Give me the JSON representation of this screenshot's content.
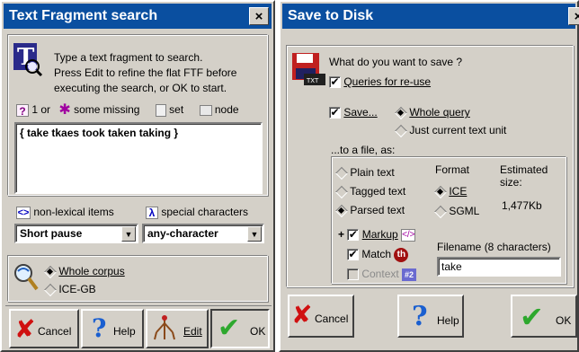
{
  "search_dialog": {
    "title": "Text Fragment search",
    "close": "×",
    "intro_line1": "Type a text fragment to search.",
    "intro_line2": "Press Edit to refine the flat FTF before",
    "intro_line3": "executing the search, or OK to start.",
    "legend": {
      "one_or": "1 or",
      "some_missing": "some missing",
      "set": "set",
      "node": "node"
    },
    "query_text": "{ take tkaes took taken taking }",
    "nonlexical_label": "non-lexical items",
    "special_chars_label": "special characters",
    "pause_select": "Short pause",
    "char_select": "any-character",
    "corpus_options": [
      "Whole corpus",
      "ICE-GB"
    ],
    "buttons": {
      "cancel": "Cancel",
      "help": "Help",
      "edit": "Edit",
      "ok": "OK"
    }
  },
  "save_dialog": {
    "title": "Save to Disk",
    "close": "×",
    "question": "What do you want to save ?",
    "queries_reuse": "Queries for re-use",
    "save_label": "Save...",
    "whole_query": "Whole query",
    "just_current": "Just current text unit",
    "to_file": "...to a file, as:",
    "plain_text": "Plain text",
    "tagged_text": "Tagged text",
    "parsed_text": "Parsed text",
    "markup": "Markup",
    "match": "Match",
    "context": "Context",
    "format_label": "Format",
    "format_ice": "ICE",
    "format_sgml": "SGML",
    "estimated_size_label": "Estimated size:",
    "estimated_size": "1,477Kb",
    "filename_label": "Filename (8 characters)",
    "filename_value": "take",
    "buttons": {
      "cancel": "Cancel",
      "help": "Help",
      "ok": "OK"
    }
  }
}
